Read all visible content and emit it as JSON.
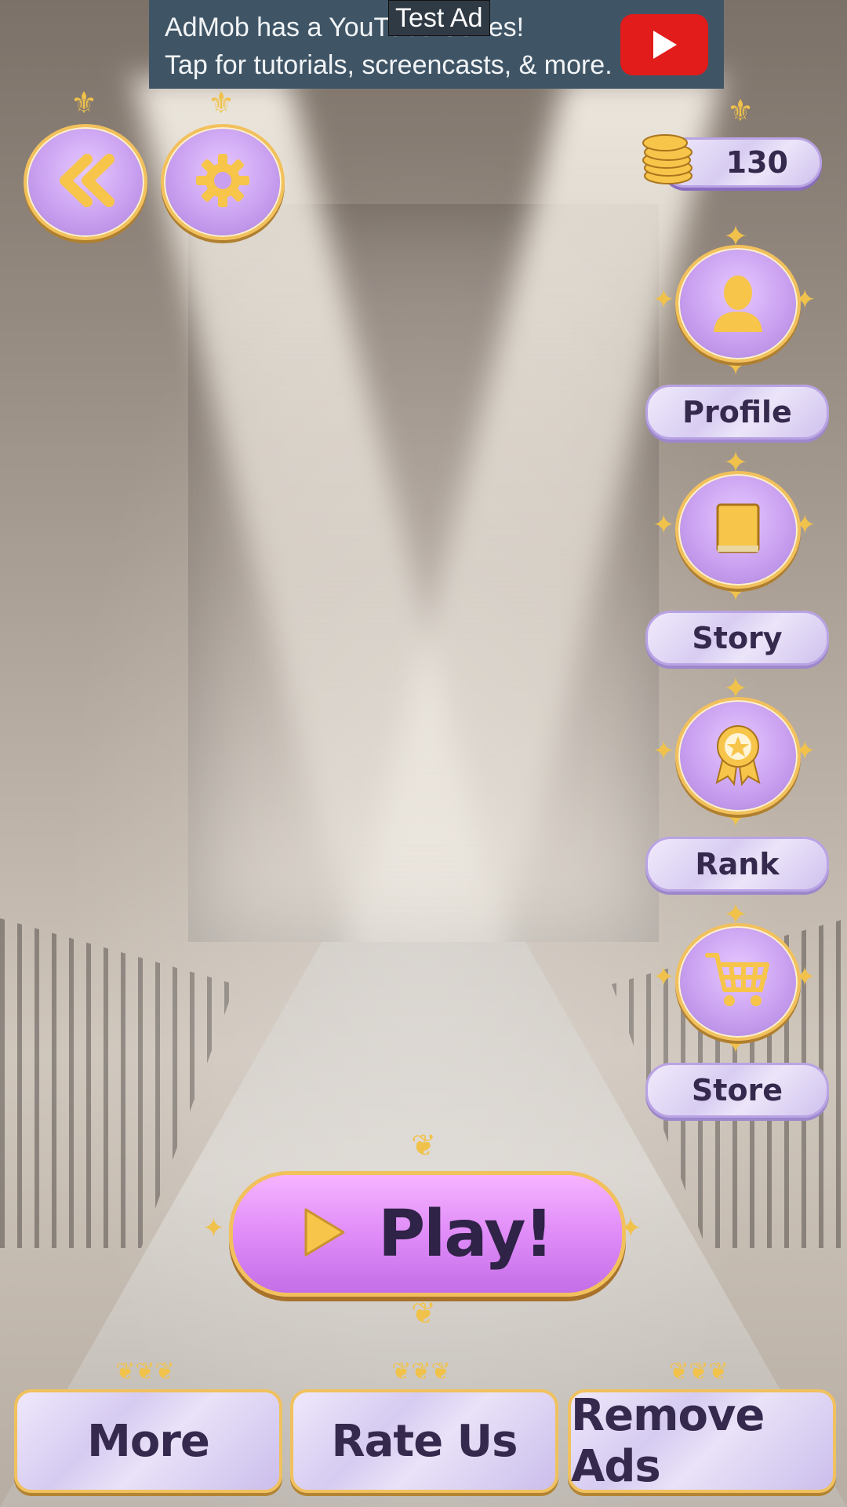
{
  "ad": {
    "line1": "AdMob has a YouTube Series!",
    "line2": "Tap for tutorials, screencasts, & more.",
    "tag": "Test Ad",
    "icon": "youtube-play-icon"
  },
  "top": {
    "back_icon": "double-chevron-left-icon",
    "settings_icon": "gear-icon",
    "coins": "130"
  },
  "side_menu": [
    {
      "label": "Profile",
      "icon": "person-icon"
    },
    {
      "label": "Story",
      "icon": "book-icon"
    },
    {
      "label": "Rank",
      "icon": "award-ribbon-icon"
    },
    {
      "label": "Store",
      "icon": "shopping-cart-icon"
    }
  ],
  "play": {
    "label": "Play!",
    "icon": "play-triangle-icon"
  },
  "bottom": {
    "more": "More",
    "rate": "Rate Us",
    "remove_ads": "Remove Ads"
  },
  "colors": {
    "accent_purple": "#c9a0f0",
    "gold": "#f2c15c",
    "text_dark": "#35294d"
  }
}
